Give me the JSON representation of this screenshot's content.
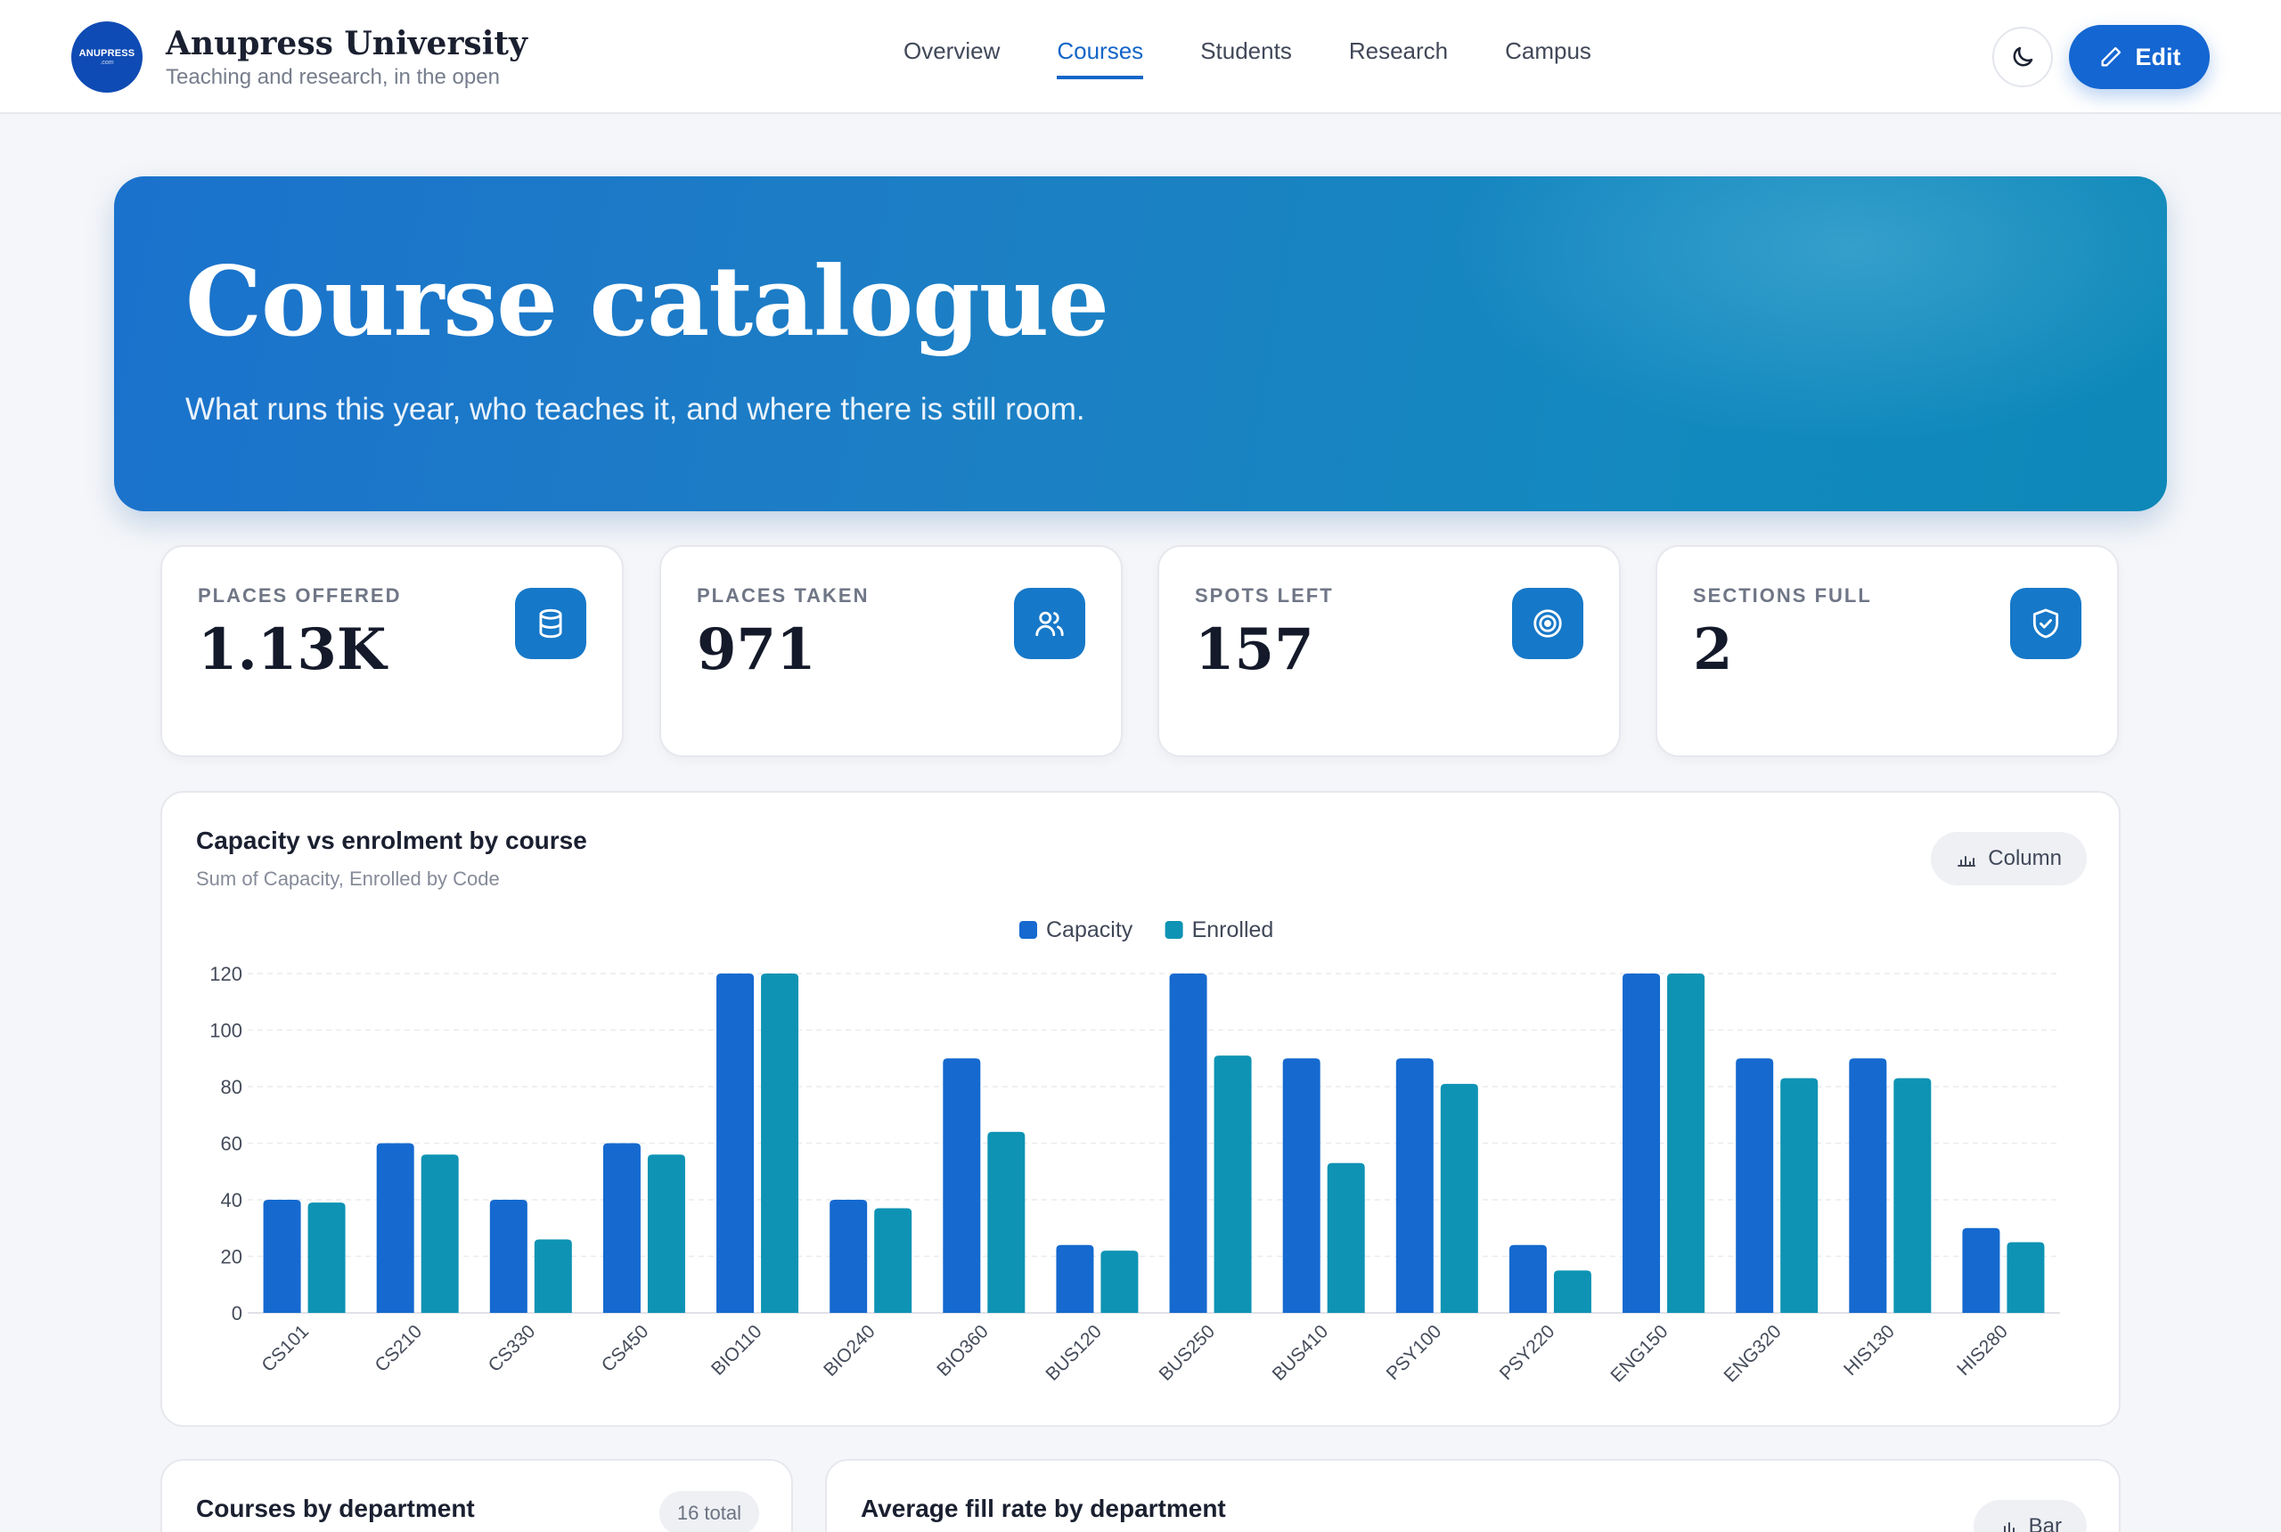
{
  "brand": {
    "logo_text": "ANUPRESS",
    "logo_sub": ".com",
    "name": "Anupress University",
    "tagline": "Teaching and research, in the open"
  },
  "nav": {
    "items": [
      {
        "label": "Overview",
        "active": false
      },
      {
        "label": "Courses",
        "active": true
      },
      {
        "label": "Students",
        "active": false
      },
      {
        "label": "Research",
        "active": false
      },
      {
        "label": "Campus",
        "active": false
      }
    ]
  },
  "actions": {
    "theme_icon": "moon-icon",
    "edit_label": "Edit",
    "edit_icon": "pencil-icon"
  },
  "hero": {
    "title": "Course catalogue",
    "subtitle": "What runs this year, who teaches it, and where there is still room."
  },
  "stats": [
    {
      "label": "PLACES OFFERED",
      "value": "1.13K",
      "icon": "database-icon"
    },
    {
      "label": "PLACES TAKEN",
      "value": "971",
      "icon": "users-icon"
    },
    {
      "label": "SPOTS LEFT",
      "value": "157",
      "icon": "target-icon"
    },
    {
      "label": "SECTIONS FULL",
      "value": "2",
      "icon": "shield-check-icon"
    }
  ],
  "chart_card": {
    "title": "Capacity vs enrolment by course",
    "subtitle": "Sum of Capacity, Enrolled by Code",
    "type_label": "Column"
  },
  "chart_data": {
    "type": "bar",
    "categories": [
      "CS101",
      "CS210",
      "CS330",
      "CS450",
      "BIO110",
      "BIO240",
      "BIO360",
      "BUS120",
      "BUS250",
      "BUS410",
      "PSY100",
      "PSY220",
      "ENG150",
      "ENG320",
      "HIS130",
      "HIS280"
    ],
    "series": [
      {
        "name": "Capacity",
        "color": "#1569cf",
        "values": [
          40,
          60,
          40,
          60,
          120,
          40,
          90,
          24,
          120,
          90,
          90,
          24,
          120,
          90,
          90,
          30
        ]
      },
      {
        "name": "Enrolled",
        "color": "#0e93b4",
        "values": [
          39,
          56,
          26,
          56,
          120,
          37,
          64,
          22,
          91,
          53,
          81,
          15,
          120,
          83,
          83,
          25
        ]
      }
    ],
    "ylim": [
      0,
      120
    ],
    "yticks": [
      0,
      20,
      40,
      60,
      80,
      100,
      120
    ],
    "legend": "top-center",
    "grid": true
  },
  "bottom_cards": {
    "dept_title": "Courses by department",
    "dept_badge": "16 total",
    "fill_title": "Average fill rate by department",
    "fill_type_label": "Bar"
  }
}
